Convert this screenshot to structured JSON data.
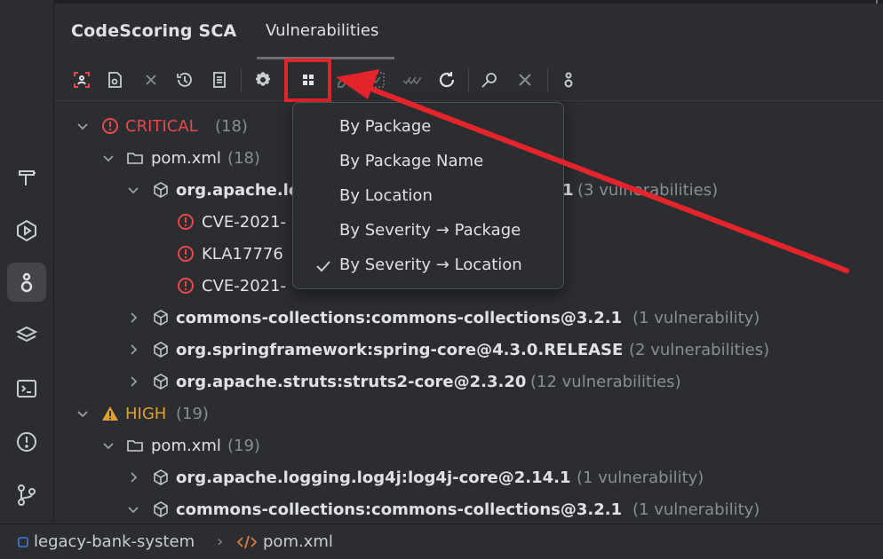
{
  "panel": {
    "title": "CodeScoring SCA",
    "tab": "Vulnerabilities"
  },
  "toolbar": {
    "buttons": [
      "scan-icon",
      "report-icon",
      "close-icon",
      "history-icon",
      "document-icon",
      "gear-icon",
      "group-by-icon",
      "eraser-icon",
      "select-icon",
      "double-check-icon",
      "refresh-icon",
      "find-icon",
      "cancel-icon",
      "plugin-icon"
    ]
  },
  "menu": {
    "items": [
      {
        "label": "By Package",
        "checked": false
      },
      {
        "label": "By Package Name",
        "checked": false
      },
      {
        "label": "By Location",
        "checked": false
      },
      {
        "label": "By Severity → Package",
        "checked": false
      },
      {
        "label": "By Severity → Location",
        "checked": true
      }
    ]
  },
  "tree": {
    "critical": {
      "label": "CRITICAL",
      "count": "(18)"
    },
    "critical_file": {
      "label": "pom.xml",
      "count": "(18)"
    },
    "pkg_log4j_partial": {
      "label": "org.apache.lo",
      "suffix": "1",
      "count": "(3 vulnerabilities)"
    },
    "cve1": {
      "label": "CVE-2021-"
    },
    "kla": {
      "label": "KLA17776"
    },
    "cve2": {
      "label": "CVE-2021-"
    },
    "pkg_commons1": {
      "label": "commons-collections:commons-collections@3.2.1",
      "count": "(1 vulnerability)"
    },
    "pkg_spring": {
      "label": "org.springframework:spring-core@4.3.0.RELEASE",
      "count": "(2 vulnerabilities)"
    },
    "pkg_struts": {
      "label": "org.apache.struts:struts2-core@2.3.20",
      "count": "(12 vulnerabilities)"
    },
    "high": {
      "label": "HIGH",
      "count": "(19)"
    },
    "high_file": {
      "label": "pom.xml",
      "count": "(19)"
    },
    "pkg_log4j_high": {
      "label": "org.apache.logging.log4j:log4j-core@2.14.1",
      "count": "(1 vulnerability)"
    },
    "pkg_commons2": {
      "label": "commons-collections:commons-collections@3.2.1",
      "count": "(1 vulnerability)"
    }
  },
  "statusbar": {
    "project": "legacy-bank-system",
    "separator": "›",
    "file": "pom.xml"
  },
  "colors": {
    "critical": "#e5484d",
    "high": "#e0a030",
    "annotation": "#e3242b"
  }
}
